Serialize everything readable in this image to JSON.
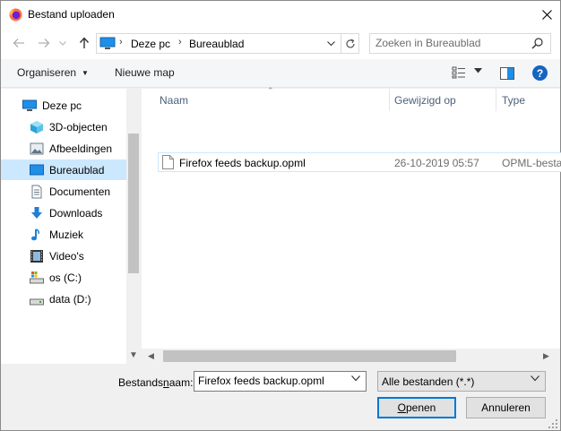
{
  "window": {
    "title": "Bestand uploaden",
    "app_icon": "firefox-icon"
  },
  "nav": {
    "breadcrumb": [
      "Deze pc",
      "Bureaublad"
    ],
    "search_placeholder": "Zoeken in Bureaublad"
  },
  "toolbar": {
    "organize_label": "Organiseren",
    "new_folder_label": "Nieuwe map",
    "help_label": "?"
  },
  "sidebar": {
    "items": [
      {
        "label": "Deze pc",
        "icon": "computer-icon"
      },
      {
        "label": "3D-objecten",
        "icon": "cube-icon"
      },
      {
        "label": "Afbeeldingen",
        "icon": "pictures-icon"
      },
      {
        "label": "Bureaublad",
        "icon": "desktop-icon",
        "selected": true
      },
      {
        "label": "Documenten",
        "icon": "documents-icon"
      },
      {
        "label": "Downloads",
        "icon": "download-arrow-icon"
      },
      {
        "label": "Muziek",
        "icon": "music-note-icon"
      },
      {
        "label": "Video's",
        "icon": "film-icon"
      },
      {
        "label": "os (C:)",
        "icon": "drive-icon"
      },
      {
        "label": "data (D:)",
        "icon": "drive-icon"
      }
    ]
  },
  "filelist": {
    "columns": [
      "Naam",
      "Gewijzigd op",
      "Type"
    ],
    "files": [
      {
        "name": "Firefox feeds backup.opml",
        "modified": "26-10-2019 05:57",
        "type": "OPML-bestand"
      }
    ]
  },
  "footer": {
    "filename_label_pre": "Bestands",
    "filename_label_u": "n",
    "filename_label_post": "aam:",
    "filename_value": "Firefox feeds backup.opml",
    "filetype_value": "Alle bestanden (*.*)",
    "open_label_u": "O",
    "open_label_rest": "penen",
    "cancel_label": "Annuleren"
  },
  "colors": {
    "accent": "#0078d7",
    "selected_bg": "#cce8ff"
  }
}
